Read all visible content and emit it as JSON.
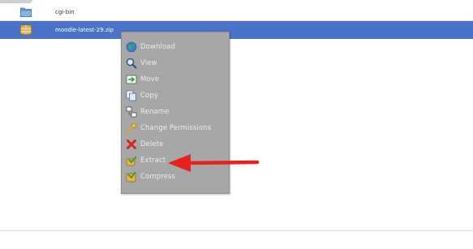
{
  "files": [
    {
      "name": "cgi-bin",
      "icon": "folder-icon",
      "selected": false
    },
    {
      "name": "moodle-latest-29.zip",
      "icon": "archive-icon",
      "selected": true
    }
  ],
  "context_menu": {
    "items": [
      {
        "label": "Download",
        "icon": "globe-download-icon"
      },
      {
        "label": "View",
        "icon": "magnifier-icon"
      },
      {
        "label": "Move",
        "icon": "move-icon"
      },
      {
        "label": "Copy",
        "icon": "copy-icon"
      },
      {
        "label": "Rename",
        "icon": "rename-icon"
      },
      {
        "label": "Change Permissions",
        "icon": "key-icon"
      },
      {
        "label": "Delete",
        "icon": "delete-icon"
      },
      {
        "label": "Extract",
        "icon": "extract-icon"
      },
      {
        "label": "Compress",
        "icon": "compress-icon"
      }
    ]
  },
  "annotation": {
    "arrow_target": "Extract",
    "arrow_color": "#e8201f"
  },
  "colors": {
    "selection": "#4a72c6",
    "menu_bg": "#a7a7a7"
  }
}
